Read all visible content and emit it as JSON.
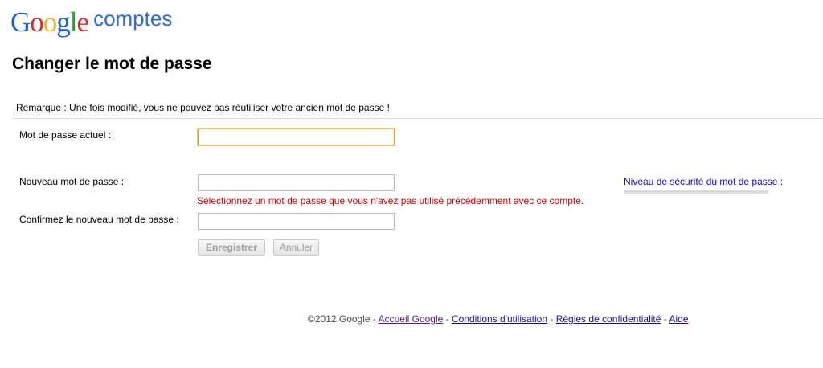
{
  "header": {
    "logo_letters": [
      "G",
      "o",
      "o",
      "g",
      "l",
      "e"
    ],
    "product": "comptes"
  },
  "page": {
    "title": "Changer le mot de passe",
    "note": "Remarque : Une fois modifié, vous ne pouvez pas réutiliser votre ancien mot de passe !"
  },
  "form": {
    "current_password": {
      "label": "Mot de passe actuel :",
      "value": ""
    },
    "new_password": {
      "label": "Nouveau mot de passe :",
      "value": ""
    },
    "error": "Sélectionnez un mot de passe que vous n'avez pas utilisé précédemment avec ce compte.",
    "confirm_password": {
      "label": "Confirmez le nouveau mot de passe :",
      "value": ""
    },
    "strength_label": "Niveau de sécurité du mot de passe :",
    "save_label": "Enregistrer",
    "cancel_label": "Annuler",
    "error_color": "#dd0000",
    "focus_border_color": "#c9a248"
  },
  "footer": {
    "copyright": "©2012 Google",
    "separator": " - ",
    "links": {
      "home": "Accueil Google",
      "terms": "Conditions d'utilisation",
      "privacy": "Règles de confidentialité",
      "help": "Aide"
    }
  }
}
